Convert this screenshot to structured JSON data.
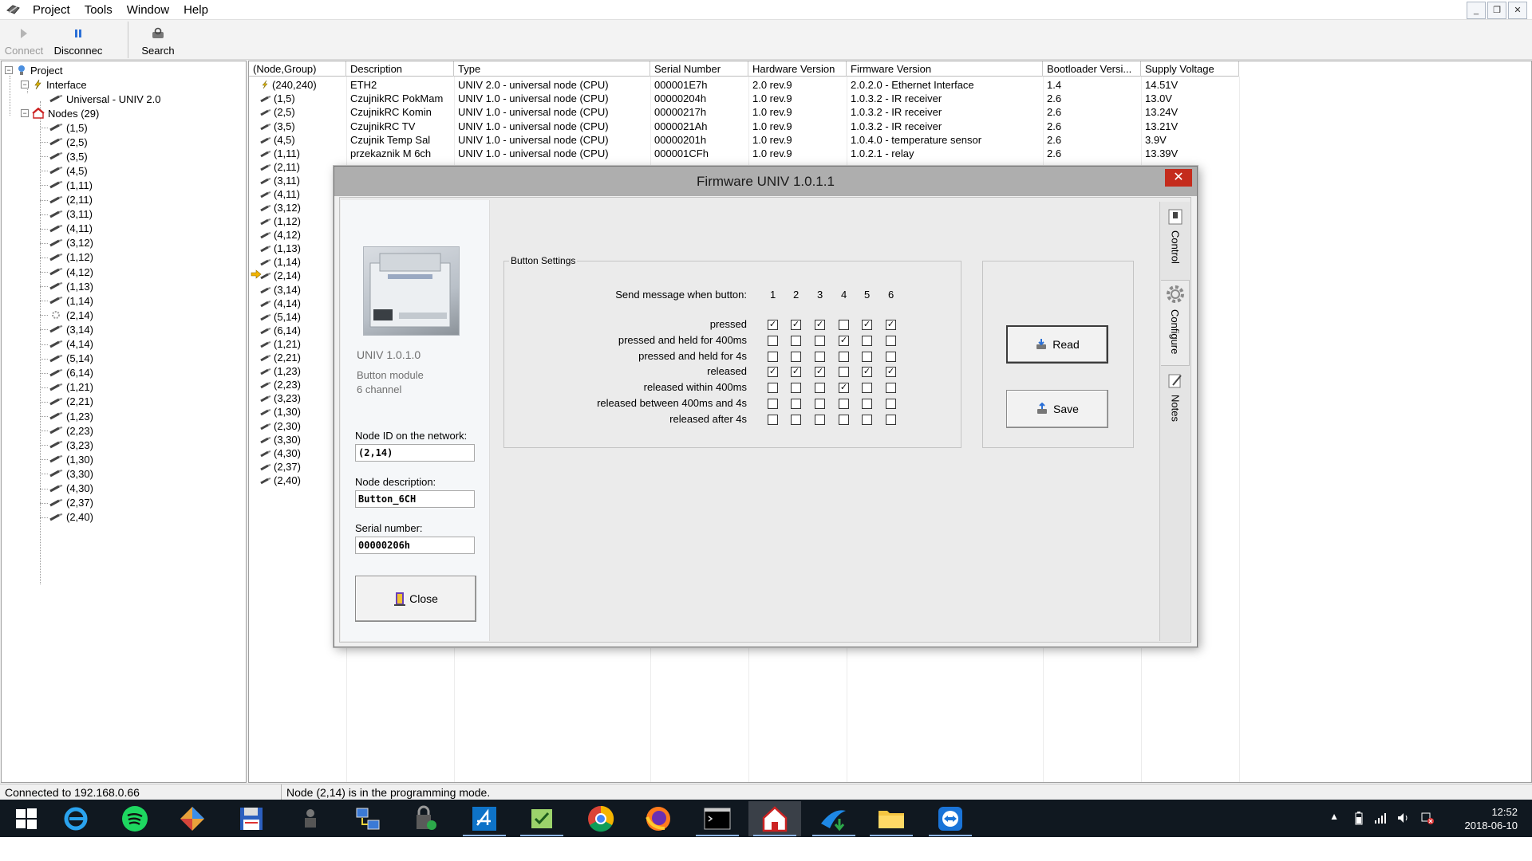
{
  "menu": [
    "Project",
    "Tools",
    "Window",
    "Help"
  ],
  "toolbar": {
    "connect": "Connect",
    "disconnect": "Disconnec",
    "search": "Search"
  },
  "tree": {
    "root": "Project",
    "interface": "Interface",
    "interface_child": "Universal - UNIV 2.0",
    "nodes": "Nodes (29)",
    "node_items": [
      "(1,5)",
      "(2,5)",
      "(3,5)",
      "(4,5)",
      "(1,11)",
      "(2,11)",
      "(3,11)",
      "(4,11)",
      "(3,12)",
      "(1,12)",
      "(4,12)",
      "(1,13)",
      "(1,14)",
      "(2,14)",
      "(3,14)",
      "(4,14)",
      "(5,14)",
      "(6,14)",
      "(1,21)",
      "(2,21)",
      "(1,23)",
      "(2,23)",
      "(3,23)",
      "(1,30)",
      "(3,30)",
      "(4,30)",
      "(2,37)",
      "(2,40)"
    ]
  },
  "grid": {
    "headers": [
      "(Node,Group)",
      "Description",
      "Type",
      "Serial Number",
      "Hardware Version",
      "Firmware Version",
      "Bootloader Versi...",
      "Supply Voltage"
    ],
    "rows": [
      [
        "(240,240)",
        "ETH2",
        "UNIV 2.0 - universal node (CPU)",
        "000001E7h",
        "2.0 rev.9",
        "2.0.2.0 - Ethernet Interface",
        "1.4",
        "14.51V"
      ],
      [
        "(1,5)",
        "CzujnikRC PokMam",
        "UNIV 1.0 - universal node (CPU)",
        "00000204h",
        "1.0 rev.9",
        "1.0.3.2 - IR receiver",
        "2.6",
        "13.0V"
      ],
      [
        "(2,5)",
        "CzujnikRC Komin",
        "UNIV 1.0 - universal node (CPU)",
        "00000217h",
        "1.0 rev.9",
        "1.0.3.2 - IR receiver",
        "2.6",
        "13.24V"
      ],
      [
        "(3,5)",
        "CzujnikRC TV",
        "UNIV 1.0 - universal node (CPU)",
        "0000021Ah",
        "1.0 rev.9",
        "1.0.3.2 - IR receiver",
        "2.6",
        "13.21V"
      ],
      [
        "(4,5)",
        "Czujnik Temp Sal",
        "UNIV 1.0 - universal node (CPU)",
        "00000201h",
        "1.0 rev.9",
        "1.0.4.0 - temperature sensor",
        "2.6",
        "3.9V"
      ],
      [
        "(1,11)",
        "przekaznik M 6ch",
        "UNIV 1.0 - universal node (CPU)",
        "000001CFh",
        "1.0 rev.9",
        "1.0.2.1 - relay",
        "2.6",
        "13.39V"
      ]
    ],
    "col_nodes": [
      "(2,11)",
      "(3,11)",
      "(4,11)",
      "(3,12)",
      "(1,12)",
      "(4,12)",
      "(1,13)",
      "(1,14)",
      "(2,14)",
      "(3,14)",
      "(4,14)",
      "(5,14)",
      "(6,14)",
      "(1,21)",
      "(2,21)",
      "(1,23)",
      "(2,23)",
      "(3,23)",
      "(1,30)",
      "(2,30)",
      "(3,30)",
      "(4,30)",
      "(2,37)",
      "(2,40)"
    ]
  },
  "status": {
    "connection": "Connected to 192.168.0.66",
    "message": "Node (2,14) is in the programming mode."
  },
  "dialog": {
    "title": "Firmware UNIV 1.0.1.1",
    "close_glyph": "✕",
    "device_name": "UNIV 1.0.1.0",
    "device_desc1": "Button module",
    "device_desc2": "6 channel",
    "node_id_label": "Node ID on the network:",
    "node_id_value": "(2,14)",
    "node_desc_label": "Node description:",
    "node_desc_value": "Button_6CH",
    "serial_label": "Serial number:",
    "serial_value": "00000206h",
    "close_button": "Close",
    "group_title": "Button Settings",
    "header_label": "Send message when button:",
    "buttons": [
      "1",
      "2",
      "3",
      "4",
      "5",
      "6"
    ],
    "rows": [
      {
        "label": "pressed",
        "checks": [
          true,
          true,
          true,
          false,
          true,
          true
        ]
      },
      {
        "label": "pressed and held for 400ms",
        "checks": [
          false,
          false,
          false,
          true,
          false,
          false
        ]
      },
      {
        "label": "pressed and held for 4s",
        "checks": [
          false,
          false,
          false,
          false,
          false,
          false
        ]
      },
      {
        "label": "released",
        "checks": [
          true,
          true,
          true,
          false,
          true,
          true
        ]
      },
      {
        "label": "released within 400ms",
        "checks": [
          false,
          false,
          false,
          true,
          false,
          false
        ]
      },
      {
        "label": "released between 400ms and 4s",
        "checks": [
          false,
          false,
          false,
          false,
          false,
          false
        ]
      },
      {
        "label": "released after 4s",
        "checks": [
          false,
          false,
          false,
          false,
          false,
          false
        ]
      }
    ],
    "read_button": "Read",
    "save_button": "Save",
    "tabs": [
      "Control",
      "Configure",
      "Notes"
    ]
  },
  "clock": {
    "time": "12:52",
    "date": "2018-06-10"
  },
  "colors": {
    "dialog_title_bg": "#aeaeae",
    "close_red": "#c42b1c",
    "taskbar": "#101820"
  }
}
